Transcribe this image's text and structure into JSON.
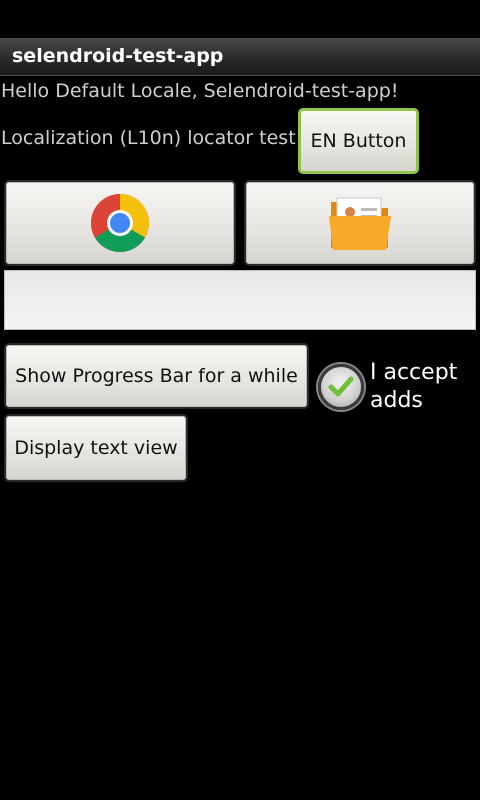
{
  "app": {
    "title": "selendroid-test-app"
  },
  "main": {
    "greeting": "Hello Default Locale, Selendroid-test-app!",
    "l10n_label": "Localization (L10n) locator test",
    "en_button": "EN Button",
    "image_buttons": {
      "left_icon": "chrome-icon",
      "right_icon": "contacts-folder-icon"
    },
    "text_field_value": "",
    "progress_button": "Show Progress Bar for a while",
    "checkbox": {
      "label": "I accept adds",
      "checked": true
    },
    "textview_button": "Display text view"
  },
  "colors": {
    "accent_focus": "#8fc54a",
    "check": "#6fbf3a"
  }
}
